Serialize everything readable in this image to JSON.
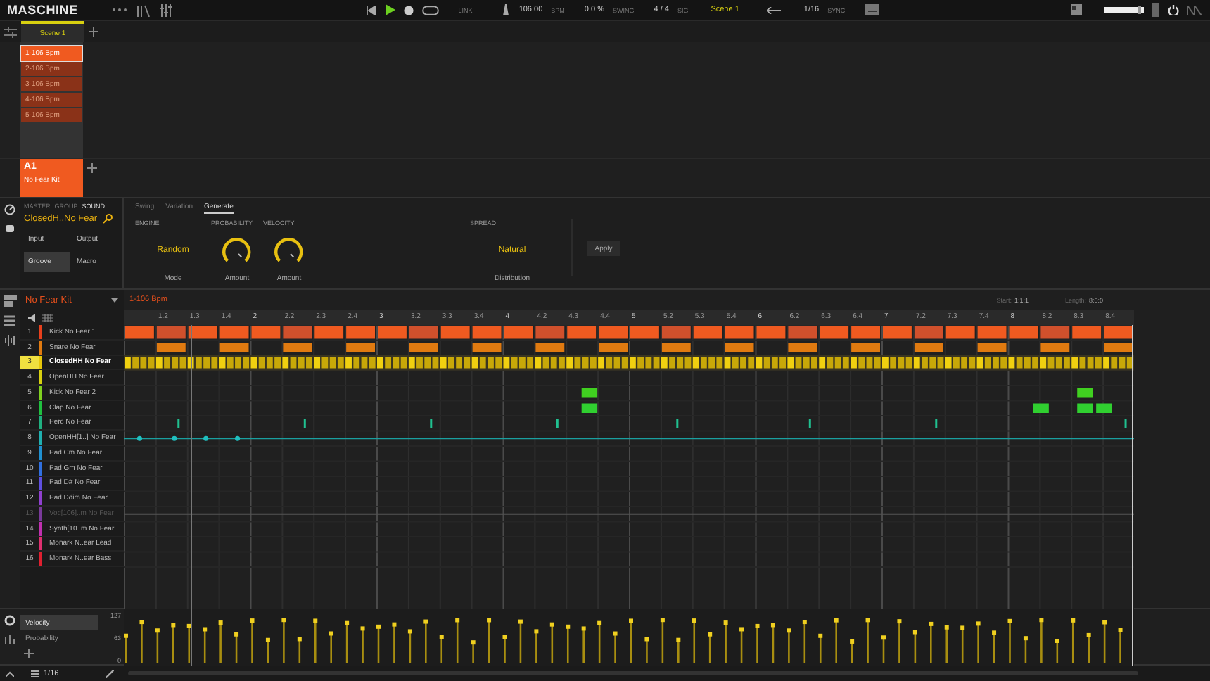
{
  "topbar": {
    "logo": "MASCHINE",
    "playing": true,
    "link": "LINK",
    "tempo": "106.00",
    "tempo_unit": "BPM",
    "swing": "0.0 %",
    "swing_label": "SWING",
    "signature": "4 / 4",
    "signature_label": "SIG",
    "scene": "Scene 1",
    "grid": "1/16",
    "sync": "SYNC"
  },
  "scenes": [
    {
      "label": "Scene 1",
      "selected": true
    }
  ],
  "patterns": [
    {
      "label": "1-106 Bpm",
      "selected": true
    },
    {
      "label": "2-106 Bpm",
      "selected": false
    },
    {
      "label": "3-106 Bpm",
      "selected": false
    },
    {
      "label": "4-106 Bpm",
      "selected": false
    },
    {
      "label": "5-106 Bpm",
      "selected": false
    }
  ],
  "group": {
    "slot": "A1",
    "name": "No Fear Kit"
  },
  "sound_panel": {
    "tabs": [
      {
        "label": "MASTER",
        "selected": false
      },
      {
        "label": "GROUP",
        "selected": false
      },
      {
        "label": "SOUND",
        "selected": true
      }
    ],
    "sound_name": "ClosedH..No Fear",
    "buttons": [
      {
        "label": "Input",
        "selected": false
      },
      {
        "label": "Output",
        "selected": false
      },
      {
        "label": "Groove",
        "selected": true
      },
      {
        "label": "Macro",
        "selected": false
      }
    ]
  },
  "generator": {
    "tabs": [
      {
        "label": "Swing",
        "selected": false
      },
      {
        "label": "Variation",
        "selected": false
      },
      {
        "label": "Generate",
        "selected": true
      }
    ],
    "engine": {
      "heading": "ENGINE",
      "value": "Random",
      "label": "Mode"
    },
    "probability": {
      "heading": "PROBABILITY",
      "label": "Amount",
      "level": 1
    },
    "velocity": {
      "heading": "VELOCITY",
      "label": "Amount",
      "level": 1
    },
    "spread": {
      "heading": "SPREAD",
      "value": "Natural",
      "label": "Distribution"
    },
    "apply": "Apply"
  },
  "editor": {
    "kit": "No Fear Kit",
    "pattern": "1-106 Bpm",
    "start_label": "Start:",
    "start": "1:1:1",
    "length_label": "Length:",
    "length": "8:0:0",
    "ruler": [
      "1.2",
      "1.3",
      "1.4",
      "2",
      "2.2",
      "2.3",
      "2.4",
      "3",
      "3.2",
      "3.3",
      "3.4",
      "4",
      "4.2",
      "4.3",
      "4.4",
      "5",
      "5.2",
      "5.3",
      "5.4",
      "6",
      "6.2",
      "6.3",
      "6.4",
      "7",
      "7.2",
      "7.3",
      "7.4",
      "8",
      "8.2",
      "8.3",
      "8.4"
    ],
    "sounds": [
      {
        "number": "1",
        "name": "Kick No Fear 1",
        "color": "#e8401c",
        "selected": false,
        "muted": false
      },
      {
        "number": "2",
        "name": "Snare No Fear",
        "color": "#e07a10",
        "selected": false,
        "muted": false
      },
      {
        "number": "3",
        "name": "ClosedHH No Fear",
        "color": "#e8c80a",
        "selected": true,
        "muted": false
      },
      {
        "number": "4",
        "name": "OpenHH No Fear",
        "color": "#d8d010",
        "selected": false,
        "muted": false
      },
      {
        "number": "5",
        "name": "Kick No Fear 2",
        "color": "#80d020",
        "selected": false,
        "muted": false
      },
      {
        "number": "6",
        "name": "Clap No Fear",
        "color": "#20c040",
        "selected": false,
        "muted": false
      },
      {
        "number": "7",
        "name": "Perc No Fear",
        "color": "#20b080",
        "selected": false,
        "muted": false
      },
      {
        "number": "8",
        "name": "OpenHH[1..] No Fear",
        "color": "#20b0b0",
        "selected": false,
        "muted": false
      },
      {
        "number": "9",
        "name": "Pad Cm No Fear",
        "color": "#2090d0",
        "selected": false,
        "muted": false
      },
      {
        "number": "10",
        "name": "Pad Gm No Fear",
        "color": "#3070e0",
        "selected": false,
        "muted": false
      },
      {
        "number": "11",
        "name": "Pad D# No Fear",
        "color": "#6050e0",
        "selected": false,
        "muted": false
      },
      {
        "number": "12",
        "name": "Pad Ddim No Fear",
        "color": "#9040d0",
        "selected": false,
        "muted": false
      },
      {
        "number": "13",
        "name": "Voc[106]..m No Fear",
        "color": "#7a3a9a",
        "selected": false,
        "muted": true
      },
      {
        "number": "14",
        "name": "Synth[10..m No Fear",
        "color": "#c030b0",
        "selected": false,
        "muted": false
      },
      {
        "number": "15",
        "name": "Monark N..ear Lead",
        "color": "#e03070",
        "selected": false,
        "muted": false
      },
      {
        "number": "16",
        "name": "Monark N..ear Bass",
        "color": "#e02030",
        "selected": false,
        "muted": false
      }
    ]
  },
  "lanes": {
    "items": [
      {
        "label": "Velocity",
        "selected": true
      },
      {
        "label": "Probability",
        "selected": false
      }
    ],
    "ticks": [
      "127",
      "63",
      "0"
    ]
  },
  "footer": {
    "grid": "1/16"
  }
}
